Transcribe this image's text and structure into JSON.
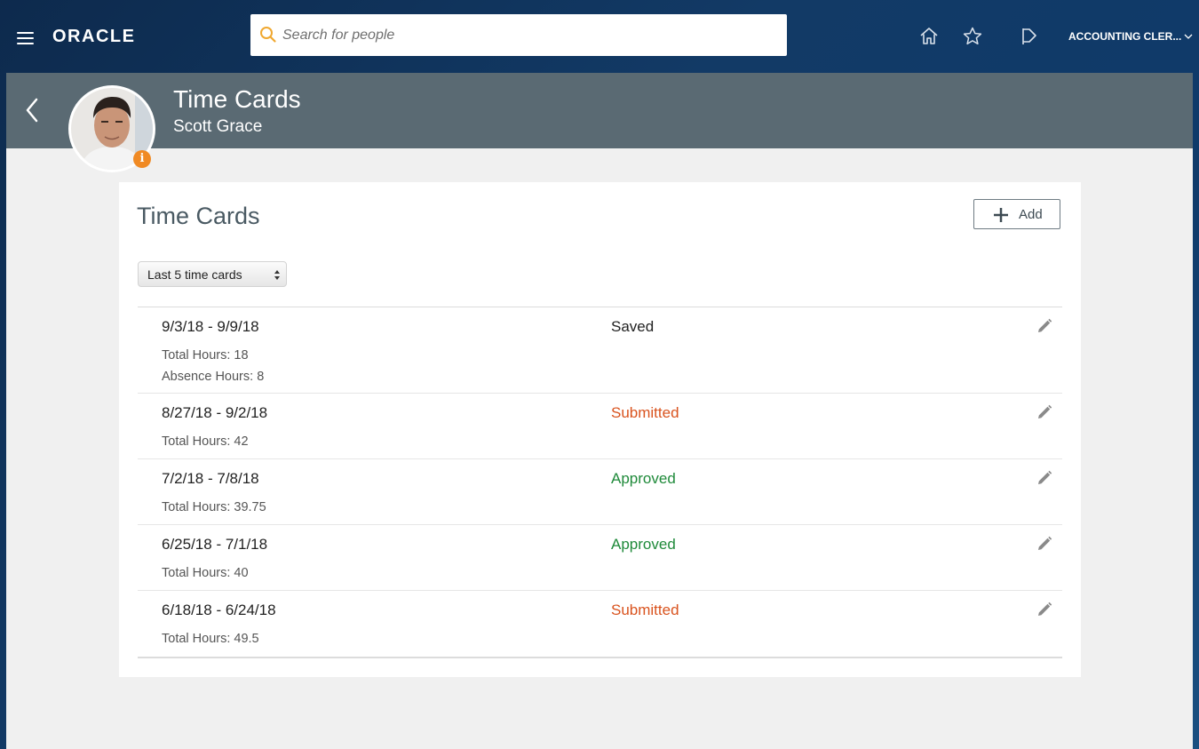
{
  "topbar": {
    "logo_text": "ORACLE",
    "search_placeholder": "Search for people",
    "icons": [
      "home-icon",
      "star-icon",
      "flag-icon"
    ],
    "user_menu_label": "ACCOUNTING CLER...",
    "user_menu_icon": "chevron-down-icon"
  },
  "header": {
    "title": "Time Cards",
    "subtitle": "Scott Grace",
    "info_badge": "i"
  },
  "card": {
    "title": "Time Cards",
    "add_label": "Add",
    "filter_selected": "Last 5 time cards"
  },
  "time_cards": [
    {
      "range": "9/3/18 - 9/9/18",
      "status": "Saved",
      "status_color": "#222222",
      "total": "Total Hours: 18",
      "absence": "Absence Hours: 8"
    },
    {
      "range": "8/27/18 - 9/2/18",
      "status": "Submitted",
      "status_color": "#d9531e",
      "total": "Total Hours: 42"
    },
    {
      "range": "7/2/18 - 7/8/18",
      "status": "Approved",
      "status_color": "#1f8a3a",
      "total": "Total Hours: 39.75"
    },
    {
      "range": "6/25/18 - 7/1/18",
      "status": "Approved",
      "status_color": "#1f8a3a",
      "total": "Total Hours: 40"
    },
    {
      "range": "6/18/18 - 6/24/18",
      "status": "Submitted",
      "status_color": "#d9531e",
      "total": "Total Hours: 49.5"
    }
  ],
  "colors": {
    "topbar_bg": "#123a66",
    "header_band": "#5a6a73",
    "content_bg": "#f0f0f0",
    "submitted": "#d9531e",
    "approved": "#1f8a3a",
    "badge": "#f08a24"
  }
}
